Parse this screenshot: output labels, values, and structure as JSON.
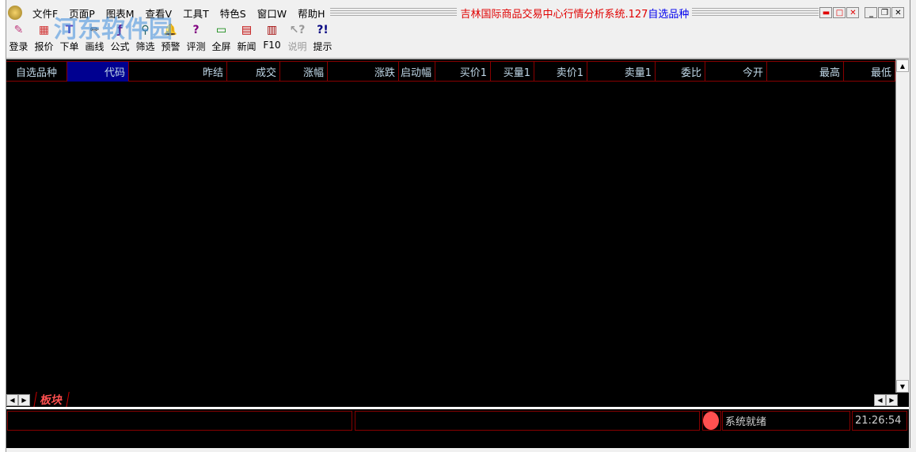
{
  "menu": [
    "文件F",
    "页面P",
    "图表M",
    "查看V",
    "工具T",
    "特色S",
    "窗口W",
    "帮助H"
  ],
  "title": {
    "main": "吉林国际商品交易中心行情分析系统.127",
    "sub": "自选品种"
  },
  "toolbar": [
    {
      "label": "登录",
      "icon": "login-icon",
      "glyph": "✎",
      "color": "#c04080"
    },
    {
      "label": "报价",
      "icon": "quote-icon",
      "glyph": "▦",
      "color": "#d03030"
    },
    {
      "label": "下单",
      "icon": "order-icon",
      "glyph": "T",
      "color": "#6040c0"
    },
    {
      "label": "画线",
      "icon": "draw-line-icon",
      "glyph": "✏",
      "color": "#404040"
    },
    {
      "label": "公式",
      "icon": "formula-icon",
      "glyph": "ƒ",
      "color": "#602090"
    },
    {
      "label": "筛选",
      "icon": "binoculars-icon",
      "glyph": "⚲",
      "color": "#206060"
    },
    {
      "label": "预警",
      "icon": "alarm-bell-icon",
      "glyph": "🔔",
      "color": "#208080"
    },
    {
      "label": "评测",
      "icon": "evaluate-icon",
      "glyph": "?",
      "color": "#800080"
    },
    {
      "label": "全屏",
      "icon": "fullscreen-icon",
      "glyph": "▭",
      "color": "#008000"
    },
    {
      "label": "新闻",
      "icon": "news-icon",
      "glyph": "▤",
      "color": "#c00000"
    },
    {
      "label": "F10",
      "icon": "books-icon",
      "glyph": "▥",
      "color": "#a00000"
    },
    {
      "label": "说明",
      "icon": "help-pointer-icon",
      "glyph": "↖?",
      "color": "#999999",
      "disabled": true
    },
    {
      "label": "提示",
      "icon": "tips-icon",
      "glyph": "?!",
      "color": "#000080"
    }
  ],
  "columns": [
    "自选品种",
    "代码",
    "昨结",
    "成交",
    "涨幅",
    "涨跌",
    "启动幅",
    "买价1",
    "买量1",
    "卖价1",
    "卖量1",
    "委比",
    "今开",
    "最高",
    "最低"
  ],
  "tabs": [
    "板块"
  ],
  "status": {
    "text": "系统就绪",
    "time": "21:26:54"
  },
  "watermark": "河东软件园"
}
